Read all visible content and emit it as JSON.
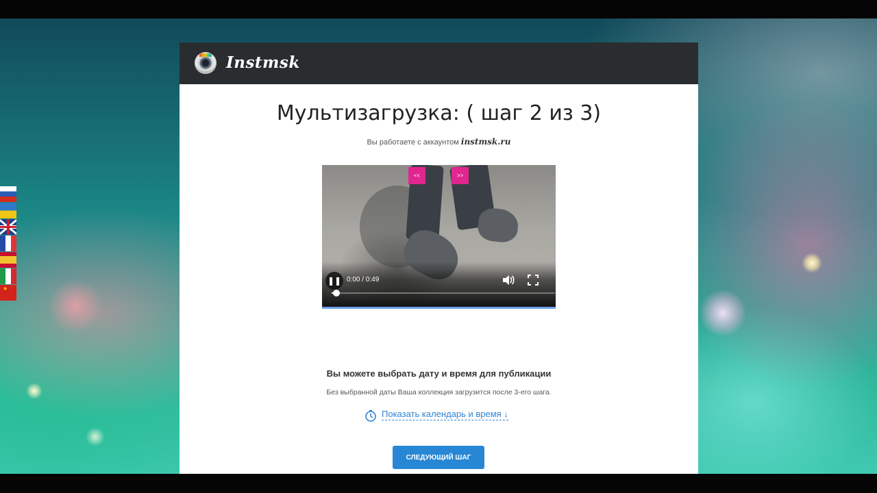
{
  "app": {
    "logo_text": "Instmsk"
  },
  "languages": [
    "ru",
    "ua",
    "en",
    "fr",
    "es",
    "it",
    "cn"
  ],
  "page": {
    "title": "Мультизагрузка: ( шаг 2 из 3)",
    "account_prefix": "Вы работаете с аккаунтом",
    "account_name": "instmsk.ru"
  },
  "video": {
    "prev_label": "<<",
    "next_label": ">>",
    "time": "0:00 / 0:49",
    "progress_fraction": 0.01,
    "state": "paused"
  },
  "schedule": {
    "title": "Вы можете выбрать дату и время для публикации",
    "hint": "Без выбранной даты Ваша коллекция загрузится после 3-его шага.",
    "link_label": "Показать календарь и время ↓"
  },
  "actions": {
    "next_step_label": "СЛЕДУЮЩИЙ ШАГ"
  },
  "colors": {
    "header_bg": "#2a2d30",
    "accent_blue": "#2787d5",
    "nav_pink": "#e0268f"
  }
}
